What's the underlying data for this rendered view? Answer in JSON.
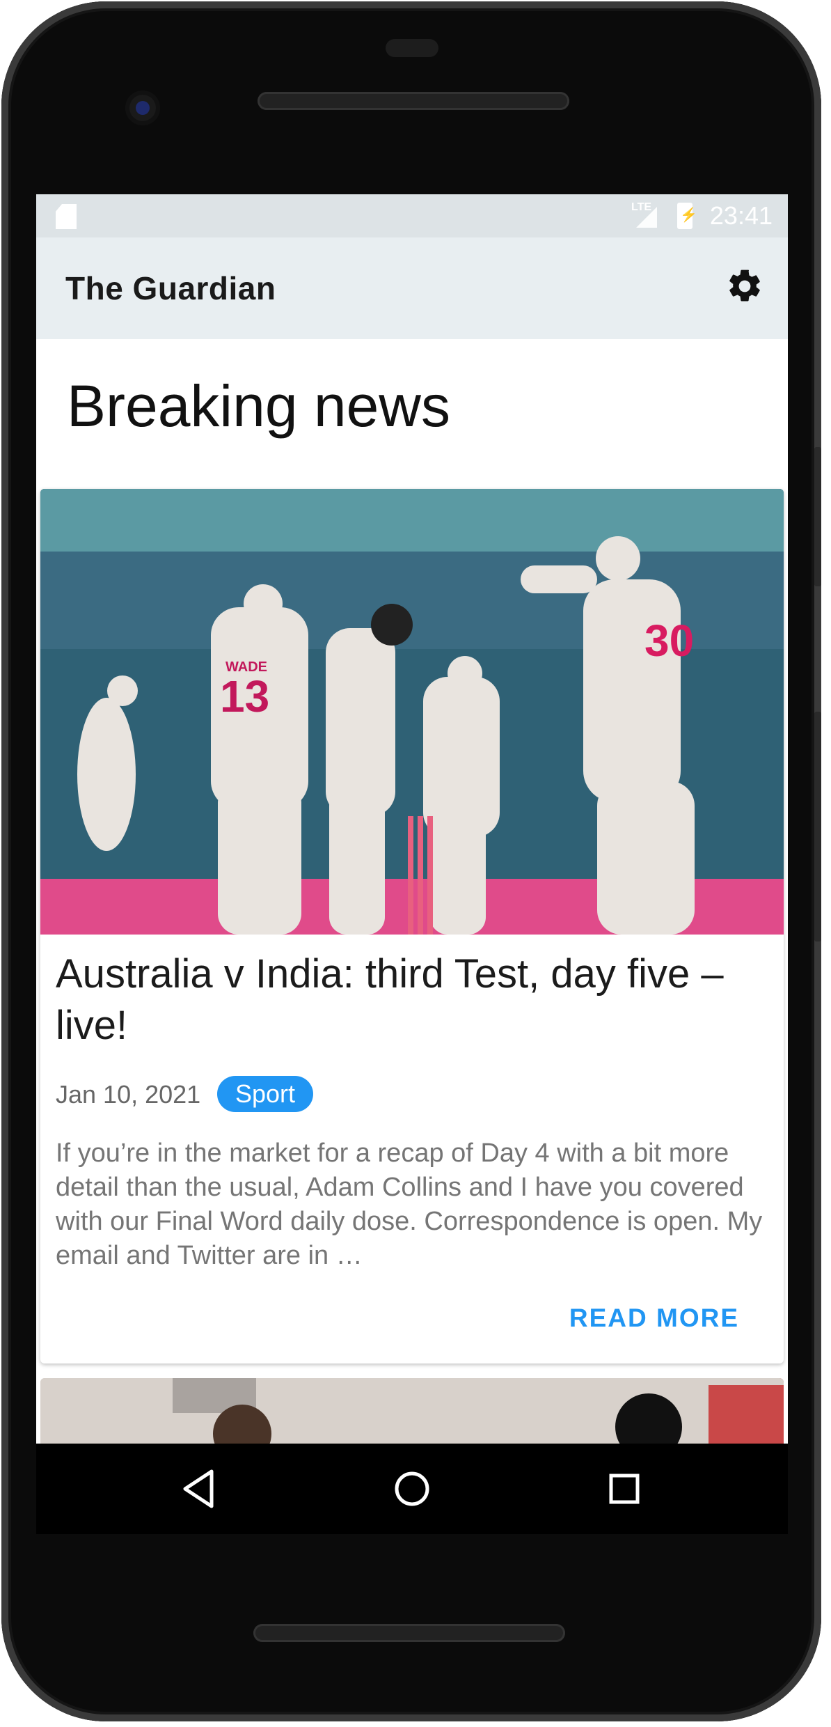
{
  "status_bar": {
    "network": "LTE",
    "time": "23:41"
  },
  "app_bar": {
    "title": "The Guardian",
    "settings_icon": "gear-icon"
  },
  "page": {
    "heading": "Breaking news"
  },
  "articles": [
    {
      "title": "Australia v India: third Test, day five – live!",
      "date": "Jan 10, 2021",
      "section": "Sport",
      "trail": "If you’re in the market for a recap of Day 4 with a bit more detail than the usual, Adam Collins and I have you covered with our Final Word daily dose. Correspondence is open. My email and Twitter are in …",
      "action": "READ MORE",
      "jerseys": [
        "WADE",
        "13",
        "30"
      ]
    }
  ],
  "nav": {
    "back_icon": "back-triangle-icon",
    "home_icon": "home-circle-icon",
    "recents_icon": "recents-square-icon"
  },
  "colors": {
    "accent": "#2196f3",
    "app_bar": "#e8eef1",
    "status_bar": "#dde3e6"
  }
}
